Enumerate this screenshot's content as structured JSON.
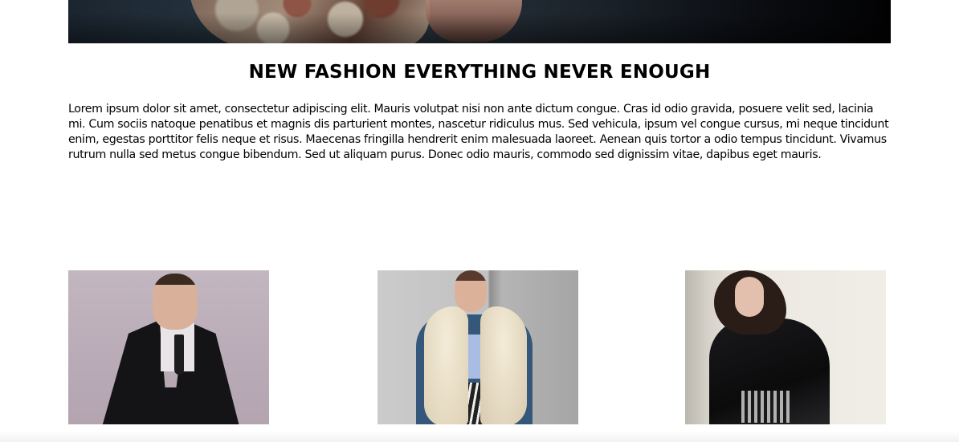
{
  "section": {
    "headline": "NEW FASHION EVERYTHING NEVER ENOUGH",
    "intro": "Lorem ipsum dolor sit amet, consectetur adipiscing elit. Mauris volutpat nisi non ante dictum congue. Cras id odio gravida, posuere velit sed, lacinia mi. Cum sociis natoque penatibus et magnis dis parturient montes, nascetur ridiculus mus. Sed vehicula, ipsum vel congue cursus, mi neque tincidunt enim, egestas porttitor felis neque et risus. Maecenas fringilla hendrerit enim malesuada laoreet. Aenean quis tortor a odio tempus tincidunt. Vivamus rutrum nulla sed metus congue bibendum. Sed ut aliquam purus. Donec odio mauris, commodo sed dignissim vitae, dapibus eget mauris."
  },
  "gallery": {
    "items": [
      {
        "subject": "man in black trench coat"
      },
      {
        "subject": "woman in denim jacket with fur stole"
      },
      {
        "subject": "woman in black leather jacket"
      }
    ]
  }
}
